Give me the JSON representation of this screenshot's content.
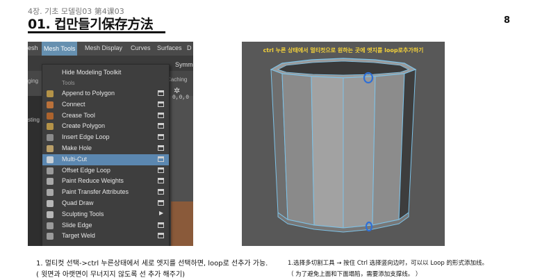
{
  "header": {
    "chapter": "4장. 기초 모델링03 第4课03",
    "title": "01. 컵만들기保存方法",
    "page_number": "8"
  },
  "maya": {
    "menubar": [
      "esh",
      "Mesh Tools",
      "Mesh Display",
      "Curves",
      "Surfaces",
      "D"
    ],
    "active_menu": "Mesh Tools",
    "right_label": "Symme",
    "side_labels": [
      "ging",
      "sting"
    ],
    "caching": "Caching",
    "coord": "0,0,0",
    "menu": {
      "header_item": "Hide Modeling Toolkit",
      "section": "Tools",
      "items": [
        {
          "label": "Append to Polygon",
          "icon": "append-polygon-icon"
        },
        {
          "label": "Connect",
          "icon": "connect-icon"
        },
        {
          "label": "Crease Tool",
          "icon": "crease-icon"
        },
        {
          "label": "Create Polygon",
          "icon": "create-polygon-icon"
        },
        {
          "label": "Insert Edge Loop",
          "icon": "edge-loop-icon"
        },
        {
          "label": "Make Hole",
          "icon": "make-hole-icon"
        },
        {
          "label": "Multi-Cut",
          "icon": "multi-cut-icon"
        },
        {
          "label": "Offset Edge Loop",
          "icon": "offset-edge-icon"
        },
        {
          "label": "Paint Reduce Weights",
          "icon": "paint-reduce-icon"
        },
        {
          "label": "Paint Transfer Attributes",
          "icon": "paint-transfer-icon"
        },
        {
          "label": "Quad Draw",
          "icon": "quad-draw-icon"
        },
        {
          "label": "Sculpting Tools",
          "icon": "submenu-arrow-icon"
        },
        {
          "label": "Slide Edge",
          "icon": "slide-edge-icon"
        },
        {
          "label": "Target Weld",
          "icon": "target-weld-icon"
        }
      ],
      "selected": "Multi-Cut"
    }
  },
  "scene": {
    "caption": "ctrl 누른 상태에서 멀티컷으로 원하는 곳에 엣지를 loop로추가하기",
    "colors": {
      "background": "#585858",
      "wire": "#7ec3e8",
      "marker": "#2f6fd6"
    }
  },
  "notes": {
    "korean": {
      "line1": "1. 멀티컷 선택->ctrl 누른상태에서 세로 엣지를 선택하면, loop로 선추가 가능.",
      "line2": "( 윗면과 아랫면이 무너지지 않도록 선 추가 해주기)"
    },
    "chinese": {
      "line1": "1.选择多切割工具 → 按住 Ctrl 选择竖向边时，可以以 Loop 的形式添加线。",
      "line2": "（ 为了避免上面和下面塌陷，需要添加支撑线。 ）"
    }
  }
}
